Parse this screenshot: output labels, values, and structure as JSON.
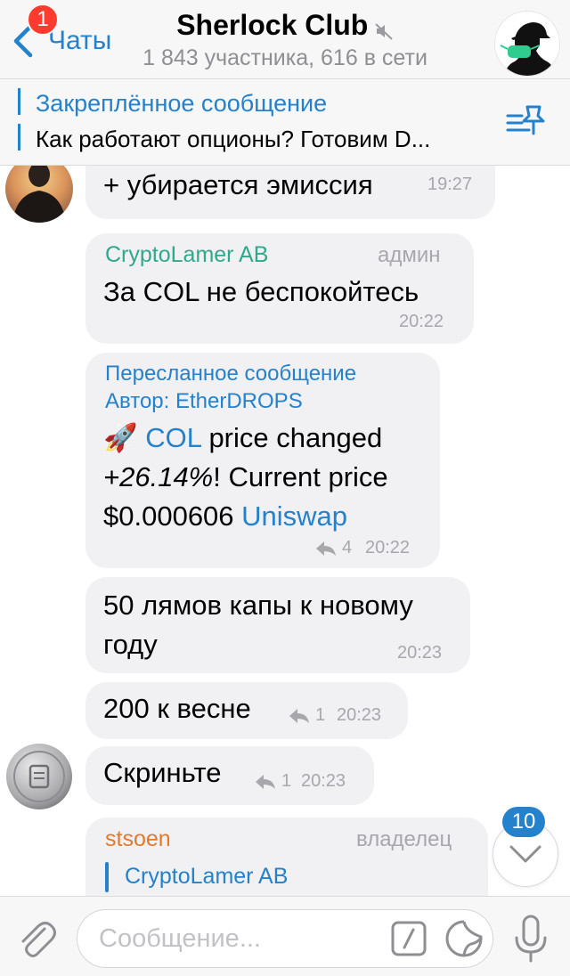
{
  "header": {
    "back_label": "Чаты",
    "unread_count": "1",
    "title": "Sherlock Club",
    "subtitle": "1 843 участника, 616 в сети"
  },
  "pinned": {
    "title": "Закреплённое сообщение",
    "text": "Как работают опционы? Готовим D..."
  },
  "messages": [
    {
      "text": "+ убирается эмиссия",
      "time": "19:27"
    },
    {
      "sender": "CryptoLamer AB",
      "role": "админ",
      "text": "За COL не беспокойтесь",
      "time": "20:22"
    },
    {
      "forward_label": "Пересланное сообщение",
      "forward_author": "Автор: EtherDROPS",
      "emoji": "🚀",
      "coin": "COL",
      "text_a": " price changed",
      "percent": "+26.14%",
      "text_b": "! Current price",
      "price": "$0.000606 ",
      "exchange": "Uniswap",
      "replies": "4",
      "time": "20:22"
    },
    {
      "text_line1": "50 лямов капы к новому",
      "text_line2": "году",
      "time": "20:23"
    },
    {
      "text": "200 к весне",
      "replies": "1",
      "time": "20:23"
    },
    {
      "text": "Скриньте",
      "replies": "1",
      "time": "20:23"
    },
    {
      "sender": "stsoen",
      "role": "владелец",
      "reply_to": "CryptoLamer AB"
    }
  ],
  "scroll_down": {
    "unread": "10"
  },
  "input": {
    "placeholder": "Сообщение..."
  },
  "colors": {
    "accent": "#2481cc",
    "admin_name": "#2fa98c",
    "owner_name": "#e07a2d",
    "badge_red": "#ff3b30",
    "bubble": "#f1f1f4"
  },
  "icons": [
    "back-chevron-icon",
    "mute-icon",
    "pin-list-icon",
    "reply-icon",
    "chevron-down-icon",
    "paperclip-icon",
    "command-icon",
    "sticker-icon",
    "microphone-icon"
  ]
}
